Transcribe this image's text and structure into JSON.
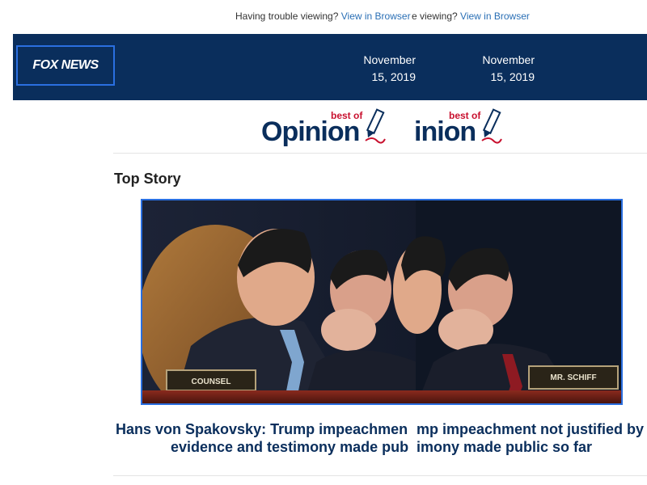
{
  "preheader": {
    "trouble_text_1": "Having trouble viewing?",
    "view_link_1": "View in Browser",
    "trouble_text_2": "e viewing?",
    "view_link_2": "View in Browser"
  },
  "header": {
    "logo_text": "FOX NEWS",
    "date_1": "November 15, 2019",
    "date_2": "November 15, 2019",
    "bg_color": "#0a2e5c"
  },
  "opinion_banner": {
    "word_1": "Opinion",
    "word_2": "inion",
    "best_of": "best of"
  },
  "top_story": {
    "section_title": "Top Story",
    "headline_1_line_1": "Hans von Spakovsky: Trump impeachmen",
    "headline_1_line_2": "evidence and testimony made pub",
    "headline_2_line_1": "mp impeachment not justified by",
    "headline_2_line_2": "imony made public so far",
    "placard_left": "COUNSEL",
    "placard_right": "MR. SCHIFF"
  }
}
